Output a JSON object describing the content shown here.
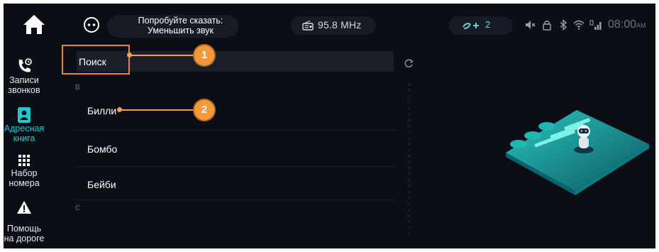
{
  "status_bar": {
    "voice_hint_line1": "Попробуйте сказать:",
    "voice_hint_line2": "Уменьшить звук",
    "radio_frequency": "95.8 MHz",
    "sync_count": "2",
    "clock_time": "08:00",
    "clock_ampm": "AM",
    "icons": [
      "home-icon",
      "voice-assistant-icon",
      "radio-icon",
      "sync-icon",
      "volume-mute-icon",
      "lock-icon",
      "bluetooth-icon",
      "wifi-icon",
      "signal-4g-icon"
    ]
  },
  "sidebar": {
    "items": [
      {
        "label_line1": "Записи",
        "label_line2": "звонков",
        "icon": "call-log-icon"
      },
      {
        "label_line1": "Адресная",
        "label_line2": "книга",
        "icon": "address-book-icon",
        "active": true
      },
      {
        "label_line1": "Набор",
        "label_line2": "номера",
        "icon": "dialpad-icon"
      },
      {
        "label_line1": "Помощь",
        "label_line2": "на дороге",
        "icon": "roadside-warning-icon"
      }
    ]
  },
  "contacts": {
    "search_label": "Поиск",
    "sections": [
      {
        "letter": "B",
        "names": [
          "Билли",
          "Бомбо",
          "Бейби"
        ]
      },
      {
        "letter": "C",
        "names": []
      }
    ],
    "alphabet": [
      "A",
      "B",
      "C",
      "D",
      "E",
      "F",
      "G",
      "H",
      "I",
      "J",
      "K",
      "L",
      "M",
      "N",
      "O",
      "P",
      "Q",
      "R",
      "S",
      "T",
      "U",
      "V",
      "W",
      "X",
      "Y",
      "Z"
    ]
  },
  "callouts": [
    {
      "number": "1"
    },
    {
      "number": "2"
    }
  ],
  "colors": {
    "background": "#0b0e14",
    "accent": "#1fc7cf",
    "callout": "#f29a3a",
    "callout_frame": "#e08a3a"
  }
}
